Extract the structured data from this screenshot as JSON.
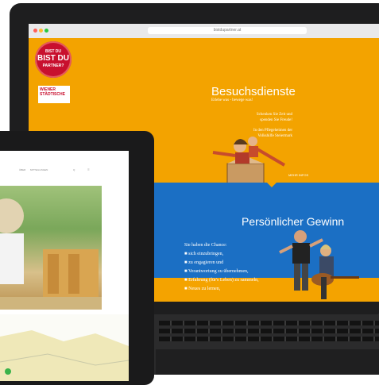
{
  "laptop": {
    "browser_url": "bistdupartner.at",
    "badge": {
      "line1": "BIST DU",
      "line2": "BIST DU",
      "line3": "PARTNER?"
    },
    "logo_text": "WIENER STÄDTISCHE",
    "headline": "Besuchsdienste",
    "subline": "Erlebe was - bewege was!",
    "promo_lines": [
      "Schenken Sie Zeit und",
      "spenden Sie Freude!",
      "",
      "In den Pflegeheimen der",
      "Volkshilfe Steiermark"
    ],
    "divider_label": "MEHR INFOS",
    "section_title": "Persönlicher Gewinn",
    "chance_intro": "Sie haben die Chance:",
    "bullets": [
      "sich einzubringen,",
      "zu engagieren und",
      "Verantwortung zu übernehmen,",
      "Erfahrung (für's Leben) zu sammeln,",
      "Neues zu lernen,"
    ]
  },
  "tablet": {
    "nav_items": [
      "ÜBER",
      "MITTEILUNGEN",
      "Q",
      "☰"
    ]
  },
  "colors": {
    "orange": "#f3a300",
    "blue": "#1b6fc4",
    "red": "#c8102e"
  }
}
